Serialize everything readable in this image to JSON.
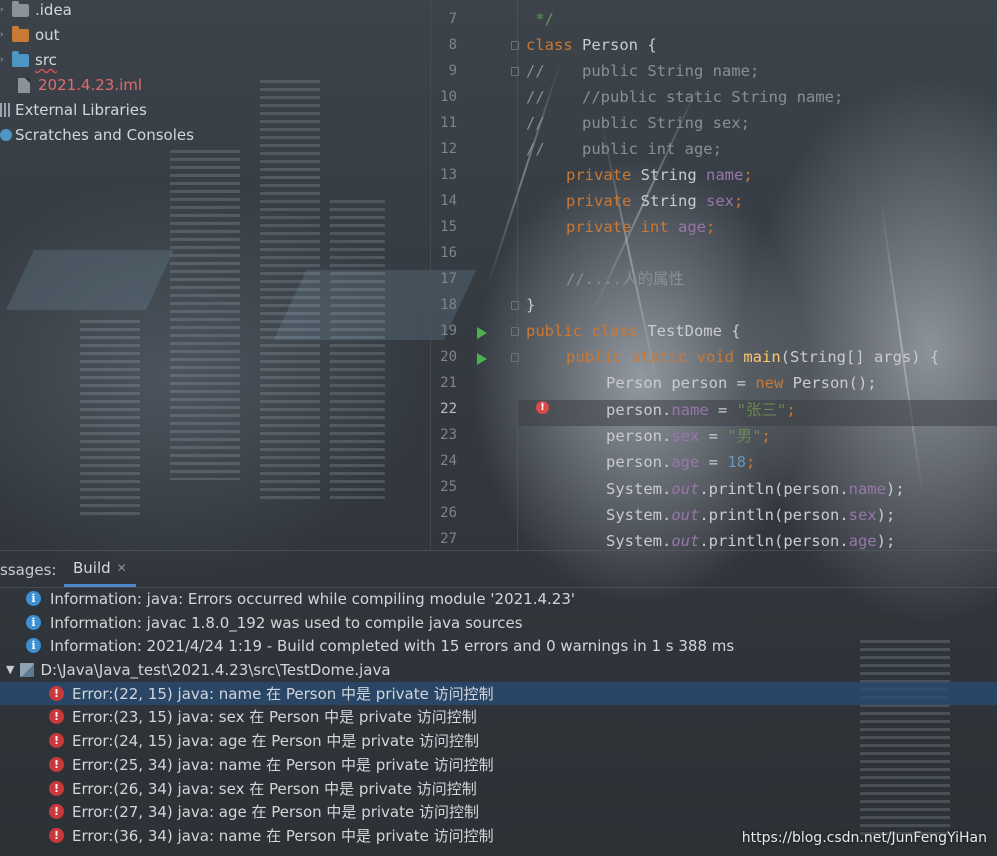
{
  "project_tree": {
    "items": [
      {
        "label": ".idea",
        "icon": "folder-icon"
      },
      {
        "label": "out",
        "icon": "folder-icon"
      },
      {
        "label": "src",
        "icon": "folder-icon"
      },
      {
        "label": "2021.4.23.iml",
        "icon": "module-file-icon"
      },
      {
        "label": "External Libraries",
        "icon": "library-icon"
      },
      {
        "label": "Scratches and Consoles",
        "icon": "scratch-icon"
      }
    ]
  },
  "editor": {
    "line_numbers": [
      "7",
      "8",
      "9",
      "10",
      "11",
      "12",
      "13",
      "14",
      "15",
      "16",
      "17",
      "18",
      "19",
      "20",
      "21",
      "22",
      "23",
      "24",
      "25",
      "26",
      "27"
    ],
    "current_line": "22",
    "code": {
      "l7": " */",
      "l8_kw": "class",
      "l8_rest": " Person {",
      "l9": "//    public String name;",
      "l10": "//    //public static String name;",
      "l11": "//    public String sex;",
      "l12": "//    public int age;",
      "l13_kw": "private",
      "l13_type": " String ",
      "l13_field": "name",
      "l13_end": ";",
      "l14_kw": "private",
      "l14_type": " String ",
      "l14_field": "sex",
      "l14_end": ";",
      "l15_kw": "private",
      "l15_type": "int",
      "l15_field": "age",
      "l15_end": ";",
      "l17": "//....人的属性",
      "l18": "}",
      "l19_kw": "public class",
      "l19_rest": " TestDome {",
      "l20_kw": "public static void",
      "l20_fn": "main",
      "l20_rest": "(String[] args) {",
      "l21_a": "Person person = ",
      "l21_kw": "new",
      "l21_b": " Person();",
      "l22_a": "person.",
      "l22_field": "name",
      "l22_b": " = ",
      "l22_str": "\"张三\"",
      "l22_c": ";",
      "l23_a": "person.",
      "l23_field": "sex",
      "l23_b": " = ",
      "l23_str": "\"男\"",
      "l23_c": ";",
      "l24_a": "person.",
      "l24_field": "age",
      "l24_b": " = ",
      "l24_num": "18",
      "l24_c": ";",
      "l25_a": "System.",
      "l25_st": "out",
      "l25_b": ".println(person.",
      "l25_field": "name",
      "l25_c": ");",
      "l26_a": "System.",
      "l26_st": "out",
      "l26_b": ".println(person.",
      "l26_field": "sex",
      "l26_c": ");",
      "l27_a": "System.",
      "l27_st": "out",
      "l27_b": ".println(person.",
      "l27_field": "age",
      "l27_c": ");"
    }
  },
  "build_panel": {
    "messages_tab_label": "ssages:",
    "build_tab_label": "Build",
    "info": [
      "Information: java: Errors occurred while compiling module '2021.4.23'",
      "Information: javac 1.8.0_192 was used to compile java sources",
      "Information: 2021/4/24 1:19 - Build completed with 15 errors and 0 warnings in 1 s 388 ms"
    ],
    "file_path": "D:\\Java\\Java_test\\2021.4.23\\src\\TestDome.java",
    "errors": [
      "Error:(22, 15)  java: name 在 Person 中是 private 访问控制",
      "Error:(23, 15)  java: sex 在 Person 中是 private 访问控制",
      "Error:(24, 15)  java: age 在 Person 中是 private 访问控制",
      "Error:(25, 34)  java: name 在 Person 中是 private 访问控制",
      "Error:(26, 34)  java: sex 在 Person 中是 private 访问控制",
      "Error:(27, 34)  java: age 在 Person 中是 private 访问控制",
      "Error:(36, 34)  java: name 在 Person 中是 private 访问控制"
    ],
    "selected_error_index": 0
  },
  "watermark": "https://blog.csdn.net/JunFengYiHan",
  "colors": {
    "keyword": "#cc7832",
    "field": "#9876aa",
    "string": "#6a8759",
    "number": "#6897bb",
    "method": "#ffc66d",
    "error": "#c9383a",
    "info": "#3d8fd1",
    "selection": "#284b73"
  }
}
